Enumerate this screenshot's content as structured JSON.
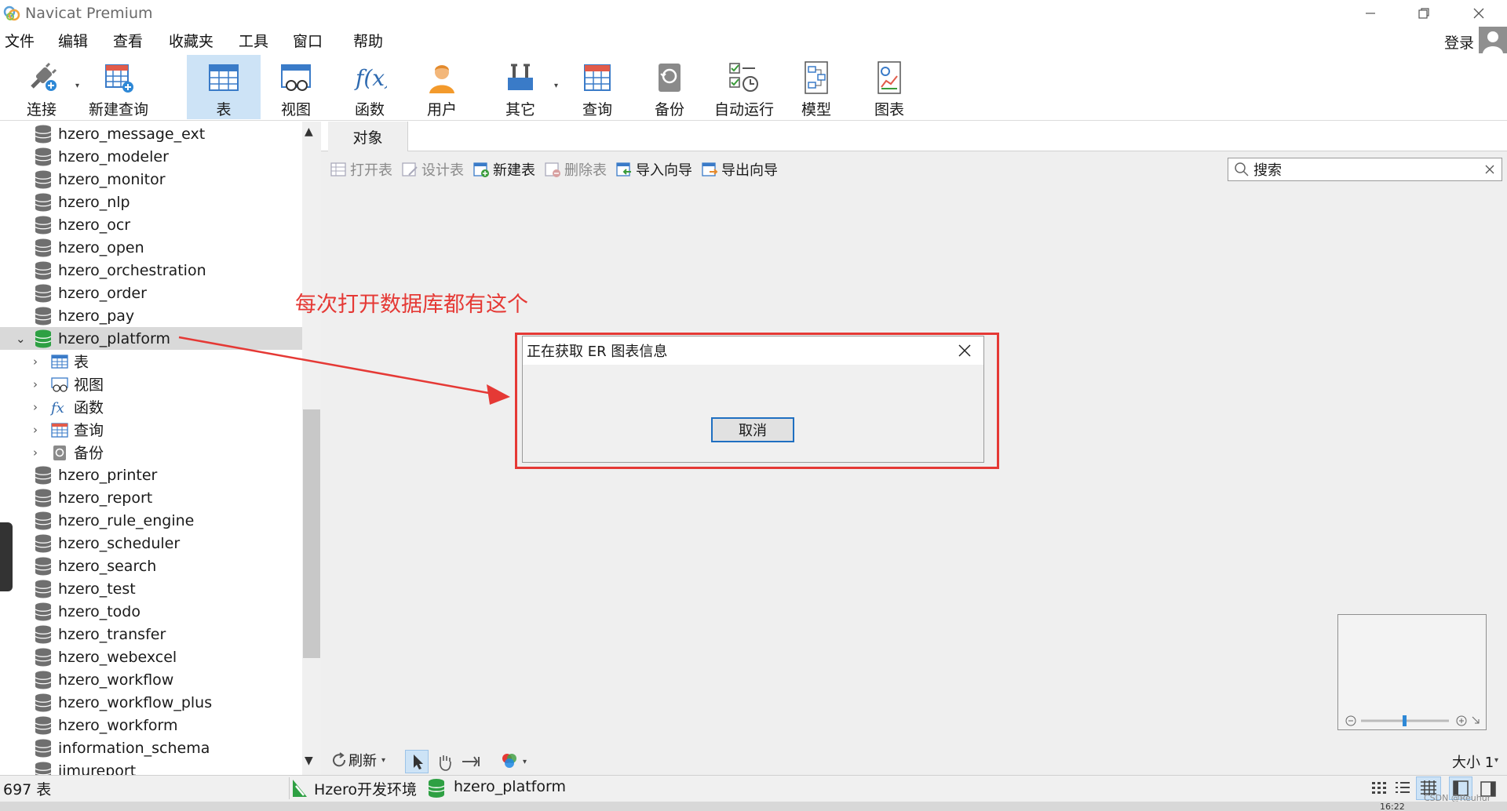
{
  "window": {
    "title": "Navicat Premium"
  },
  "menu": [
    "文件",
    "编辑",
    "查看",
    "收藏夹",
    "工具",
    "窗口",
    "帮助"
  ],
  "account": {
    "login_label": "登录"
  },
  "toolbar": [
    {
      "label": "连接",
      "icon": "plug-icon"
    },
    {
      "label": "新建查询",
      "icon": "new-query-icon"
    },
    {
      "label": "表",
      "icon": "table-icon",
      "active": true
    },
    {
      "label": "视图",
      "icon": "view-icon"
    },
    {
      "label": "函数",
      "icon": "function-icon"
    },
    {
      "label": "用户",
      "icon": "user-icon"
    },
    {
      "label": "其它",
      "icon": "tools-icon"
    },
    {
      "label": "查询",
      "icon": "query-icon"
    },
    {
      "label": "备份",
      "icon": "backup-icon"
    },
    {
      "label": "自动运行",
      "icon": "schedule-icon"
    },
    {
      "label": "模型",
      "icon": "model-icon"
    },
    {
      "label": "图表",
      "icon": "chart-icon"
    }
  ],
  "sidebar": {
    "items_before": [
      "hzero_message_ext",
      "hzero_modeler",
      "hzero_monitor",
      "hzero_nlp",
      "hzero_ocr",
      "hzero_open",
      "hzero_orchestration",
      "hzero_order",
      "hzero_pay"
    ],
    "selected": "hzero_platform",
    "children": [
      {
        "label": "表",
        "icon": "table-icon"
      },
      {
        "label": "视图",
        "icon": "view-icon"
      },
      {
        "label": "函数",
        "icon": "function-icon"
      },
      {
        "label": "查询",
        "icon": "query-icon"
      },
      {
        "label": "备份",
        "icon": "backup-icon"
      }
    ],
    "items_after": [
      "hzero_printer",
      "hzero_report",
      "hzero_rule_engine",
      "hzero_scheduler",
      "hzero_search",
      "hzero_test",
      "hzero_todo",
      "hzero_transfer",
      "hzero_webexcel",
      "hzero_workflow",
      "hzero_workflow_plus",
      "hzero_workform",
      "information_schema",
      "jimureport"
    ]
  },
  "content": {
    "tab": "对象",
    "object_toolbar": [
      {
        "label": "打开表",
        "enabled": false
      },
      {
        "label": "设计表",
        "enabled": false
      },
      {
        "label": "新建表",
        "enabled": true
      },
      {
        "label": "删除表",
        "enabled": false
      },
      {
        "label": "导入向导",
        "enabled": true
      },
      {
        "label": "导出向导",
        "enabled": true
      }
    ],
    "search_placeholder": "搜索",
    "annotation": "每次打开数据库都有这个",
    "dialog": {
      "title": "正在获取 ER 图表信息",
      "cancel_label": "取消"
    },
    "bottom_toolbar": {
      "refresh_label": "刷新",
      "size_label": "大小 1"
    }
  },
  "status": {
    "count": "697 表",
    "connection": "Hzero开发环境",
    "database": "hzero_platform",
    "watermark": "CSDN @Reuhur",
    "time": "16:22"
  },
  "colors": {
    "accent": "#1f6fc1",
    "annotation": "#e53935",
    "selected_bg": "#d9d9d9",
    "active_tool_bg": "#cde3f6"
  }
}
